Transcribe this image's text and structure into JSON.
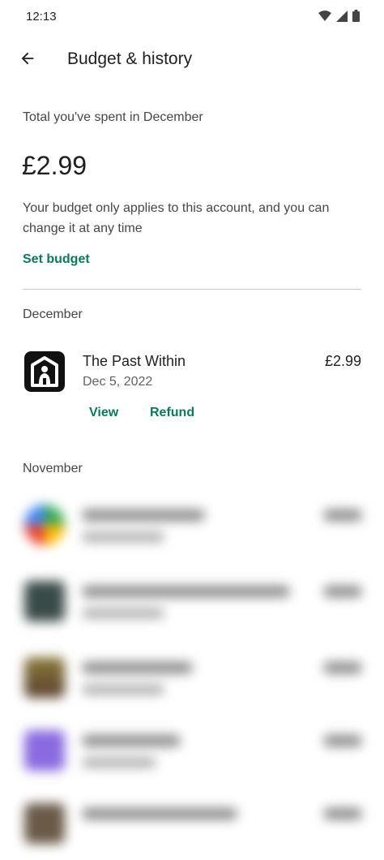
{
  "status_bar": {
    "time": "12:13",
    "icons": [
      "wifi-icon",
      "signal-icon",
      "battery-icon"
    ]
  },
  "app_bar": {
    "back_icon": "arrow-back-icon",
    "title": "Budget & history"
  },
  "summary": {
    "label": "Total you've spent in December",
    "amount": "£2.99",
    "description": "Your budget only applies to this account, and you can change it at any time",
    "set_budget_label": "Set budget"
  },
  "december": {
    "label": "December",
    "transaction": {
      "name": "The Past Within",
      "date": "Dec 5, 2022",
      "price": "£2.99",
      "view_label": "View",
      "refund_label": "Refund"
    }
  },
  "november": {
    "label": "November"
  },
  "colors": {
    "accent": "#0b7a5a",
    "text_primary": "#1f1f1f",
    "text_secondary": "#444746"
  }
}
